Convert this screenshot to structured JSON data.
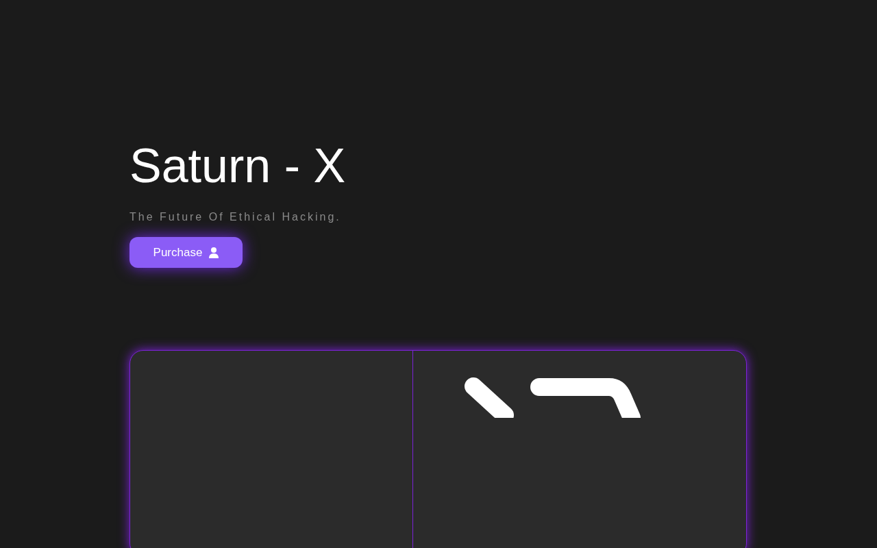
{
  "hero": {
    "title": "Saturn - X",
    "tagline": "The Future Of Ethical Hacking.",
    "button": {
      "label": "Purchase"
    }
  }
}
